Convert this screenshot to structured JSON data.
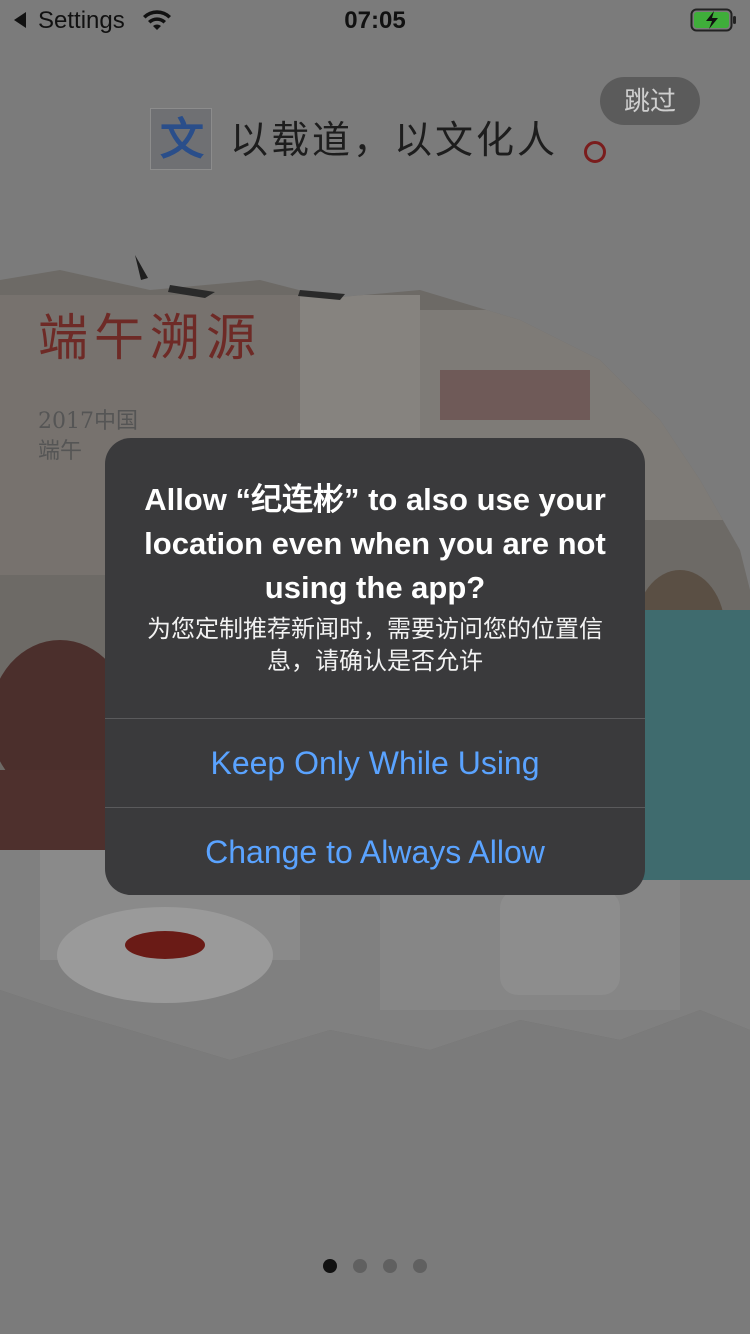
{
  "status_bar": {
    "back_label": "Settings",
    "time": "07:05",
    "icons": [
      "back-arrow-icon",
      "wifi-icon",
      "battery-charging-icon"
    ]
  },
  "splash": {
    "skip_label": "跳过",
    "logo_char": "文",
    "slogan": "以载道，以文化人",
    "photo_caption_title": "端午溯源",
    "photo_caption_sub1": "2017中国",
    "photo_caption_sub2": "端午"
  },
  "alert": {
    "title": "Allow “纪连彬” to also use your location even when you are not using the app?",
    "message": "为您定制推荐新闻时，需要访问您的位置信息，请确认是否允许",
    "buttons": [
      {
        "label": "Keep Only While Using"
      },
      {
        "label": "Change to Always Allow"
      }
    ]
  },
  "pager": {
    "total": 4,
    "active_index": 0
  },
  "colors": {
    "dim_background": "#7b7b7b",
    "alert_background": "#3a3a3c",
    "alert_button_text": "#5aa3ff",
    "logo_blue": "#2a4e8a",
    "accent_red": "#7a1d1d"
  }
}
